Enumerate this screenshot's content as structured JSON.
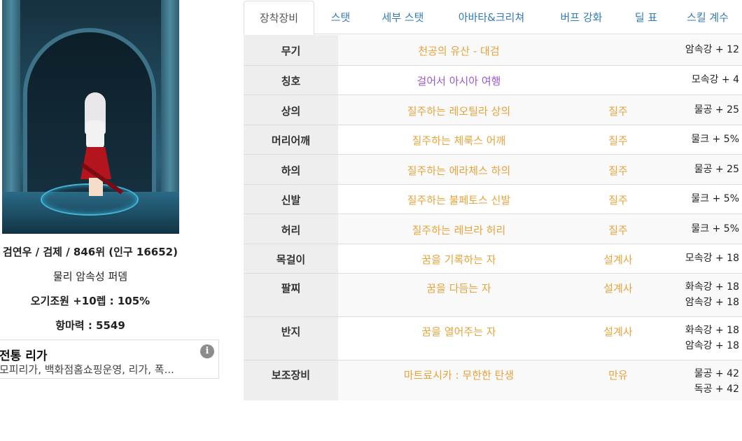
{
  "character": {
    "summary": "검연우 / 검제 / 846위 (인구 16652)",
    "build": "물리 암속성 퍼뎀",
    "aura": "오기조원 +10렙 : 105%",
    "magic_resist": "항마력 : 5549"
  },
  "guild": {
    "name": "전통 리가",
    "members": "모피리가, 백화점홈쇼핑운영, 리가, 폭..."
  },
  "tabs": [
    "장착장비",
    "스탯",
    "세부 스탯",
    "아바타&크리쳐",
    "버프 강화",
    "딜 표",
    "스킬 계수"
  ],
  "active_tab": "장착장비",
  "colors": {
    "item_default": "#e8a33a",
    "item_title": "#9b59d0",
    "tab_link": "#337ab7",
    "slot_bg": "#eeeeee"
  },
  "equipment": [
    {
      "slot": "무기",
      "item": "천공의 유산 - 대검",
      "set": "",
      "stats": [
        "암속강 + 12"
      ],
      "item_color": "#e8a33a"
    },
    {
      "slot": "칭호",
      "item": "걸어서 아시아 여행",
      "set": "",
      "stats": [
        "모속강 + 4"
      ],
      "item_color": "#9b59d0"
    },
    {
      "slot": "상의",
      "item": "질주하는 레오틸라 상의",
      "set": "질주",
      "stats": [
        "물공 + 25"
      ],
      "item_color": "#e8a33a"
    },
    {
      "slot": "머리어깨",
      "item": "질주하는 체룩스 어깨",
      "set": "질주",
      "stats": [
        "물크 + 5%"
      ],
      "item_color": "#e8a33a"
    },
    {
      "slot": "하의",
      "item": "질주하는 에라체스 하의",
      "set": "질주",
      "stats": [
        "물공 + 25"
      ],
      "item_color": "#e8a33a"
    },
    {
      "slot": "신발",
      "item": "질주하는 불페토스 신발",
      "set": "질주",
      "stats": [
        "물크 + 5%"
      ],
      "item_color": "#e8a33a"
    },
    {
      "slot": "허리",
      "item": "질주하는 레브라 허리",
      "set": "질주",
      "stats": [
        "물크 + 5%"
      ],
      "item_color": "#e8a33a"
    },
    {
      "slot": "목걸이",
      "item": "꿈을 기록하는 자",
      "set": "설계사",
      "stats": [
        "모속강 + 18"
      ],
      "item_color": "#e8a33a"
    },
    {
      "slot": "팔찌",
      "item": "꿈을 다듬는 자",
      "set": "설계사",
      "stats": [
        "화속강 + 18",
        "암속강 + 18"
      ],
      "item_color": "#e8a33a"
    },
    {
      "slot": "반지",
      "item": "꿈을 열어주는 자",
      "set": "설계사",
      "stats": [
        "화속강 + 18",
        "암속강 + 18"
      ],
      "item_color": "#e8a33a"
    },
    {
      "slot": "보조장비",
      "item": "마트료시카 : 무한한 탄생",
      "set": "만유",
      "stats": [
        "물공 + 42",
        "독공 + 42"
      ],
      "item_color": "#e8a33a"
    }
  ]
}
